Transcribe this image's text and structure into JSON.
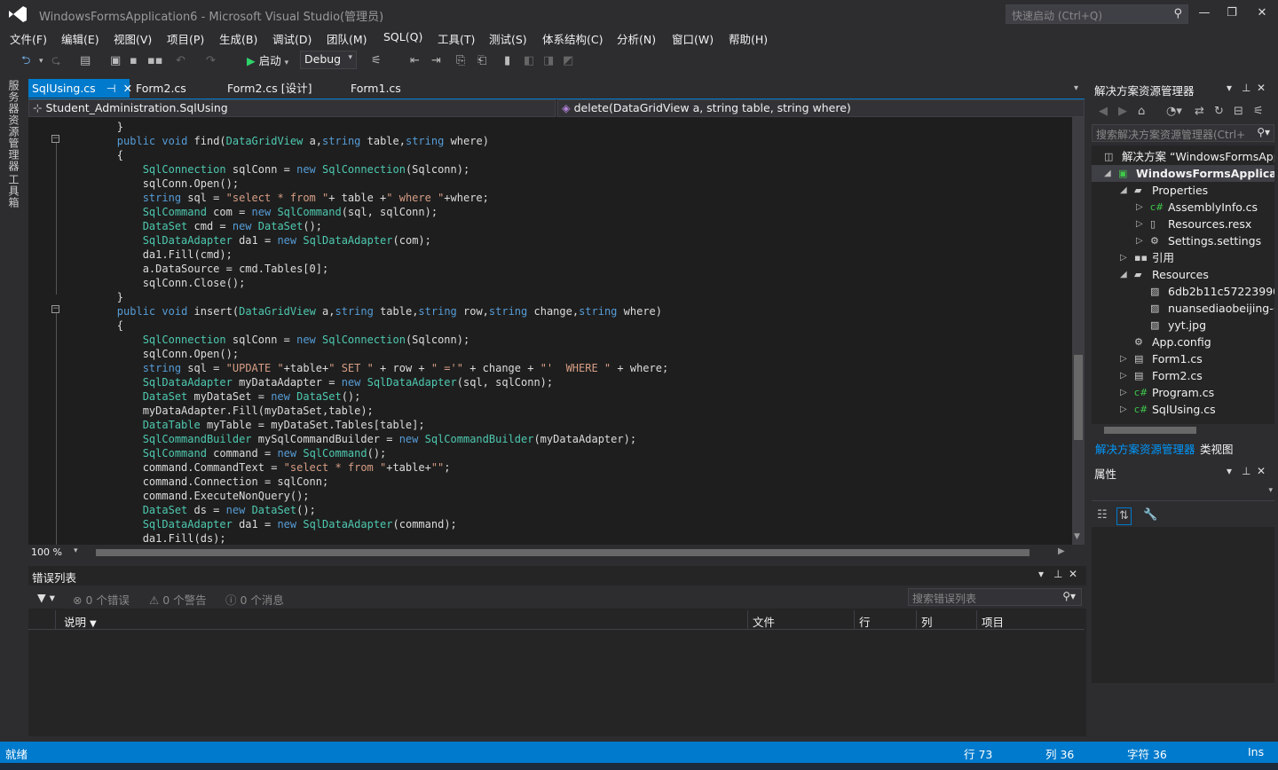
{
  "title": {
    "window_title": "WindowsFormsApplication6 - Microsoft Visual Studio(管理员)",
    "quick_launch": "快速启动 (Ctrl+Q)"
  },
  "menu": [
    "文件(F)",
    "编辑(E)",
    "视图(V)",
    "项目(P)",
    "生成(B)",
    "调试(D)",
    "团队(M)",
    "SQL(Q)",
    "工具(T)",
    "测试(S)",
    "体系结构(C)",
    "分析(N)",
    "窗口(W)",
    "帮助(H)"
  ],
  "toolbar": {
    "start_label": "启动",
    "config": "Debug"
  },
  "left_tabs": [
    "服务器资源管理器",
    "工具箱"
  ],
  "tabs": [
    "SqlUsing.cs",
    "Form2.cs",
    "Form2.cs [设计]",
    "Form1.cs"
  ],
  "nav": {
    "left": "Student_Administration.SqlUsing",
    "right": "delete(DataGridView a, string table, string where)"
  },
  "code_lines": [
    "        }",
    "        public void find(DataGridView a,string table,string where)",
    "        {",
    "            SqlConnection sqlConn = new SqlConnection(Sqlconn);",
    "            sqlConn.Open();",
    "            string sql = \"select * from \"+ table +\" where \"+where;",
    "            SqlCommand com = new SqlCommand(sql, sqlConn);",
    "            DataSet cmd = new DataSet();",
    "            SqlDataAdapter da1 = new SqlDataAdapter(com);",
    "            da1.Fill(cmd);",
    "            a.DataSource = cmd.Tables[0];",
    "            sqlConn.Close();",
    "        }",
    "        public void insert(DataGridView a,string table,string row,string change,string where)",
    "        {",
    "            SqlConnection sqlConn = new SqlConnection(Sqlconn);",
    "            sqlConn.Open();",
    "            string sql = \"UPDATE \"+table+\" SET \" + row + \" ='\" + change + \"'  WHERE \" + where;",
    "            SqlDataAdapter myDataAdapter = new SqlDataAdapter(sql, sqlConn);",
    "            DataSet myDataSet = new DataSet();",
    "            myDataAdapter.Fill(myDataSet,table);",
    "            DataTable myTable = myDataSet.Tables[table];",
    "            SqlCommandBuilder mySqlCommandBuilder = new SqlCommandBuilder(myDataAdapter);",
    "            SqlCommand command = new SqlCommand();",
    "            command.CommandText = \"select * from \"+table+\"\";",
    "            command.Connection = sqlConn;",
    "            command.ExecuteNonQuery();",
    "            DataSet ds = new DataSet();",
    "            SqlDataAdapter da1 = new SqlDataAdapter(command);",
    "            da1.Fill(ds);"
  ],
  "editor": {
    "zoom": "100 %"
  },
  "error_list": {
    "title": "错误列表",
    "errors": "0 个错误",
    "warnings": "0 个警告",
    "messages": "0 个消息",
    "search_placeholder": "搜索错误列表",
    "columns": [
      "说明",
      "文件",
      "行",
      "列",
      "项目"
    ]
  },
  "solution_explorer": {
    "title": "解决方案资源管理器",
    "search_placeholder": "搜索解决方案资源管理器(Ctrl+",
    "items": [
      {
        "label": "解决方案 “WindowsFormsApp",
        "icon": "solution-icon"
      },
      {
        "label": "WindowsFormsApplicatio",
        "icon": "csharp-project-icon"
      },
      {
        "label": "Properties",
        "icon": "properties-icon"
      },
      {
        "label": "AssemblyInfo.cs",
        "icon": "csharp-file-icon"
      },
      {
        "label": "Resources.resx",
        "icon": "resx-icon"
      },
      {
        "label": "Settings.settings",
        "icon": "settings-icon"
      },
      {
        "label": "引用",
        "icon": "references-icon"
      },
      {
        "label": "Resources",
        "icon": "folder-icon"
      },
      {
        "label": "6db2b11c57223990",
        "icon": "image-icon"
      },
      {
        "label": "nuansediaobeijing-(",
        "icon": "image-icon"
      },
      {
        "label": "yyt.jpg",
        "icon": "image-icon"
      },
      {
        "label": "App.config",
        "icon": "config-icon"
      },
      {
        "label": "Form1.cs",
        "icon": "form-icon"
      },
      {
        "label": "Form2.cs",
        "icon": "form-icon"
      },
      {
        "label": "Program.cs",
        "icon": "csharp-file-icon"
      },
      {
        "label": "SqlUsing.cs",
        "icon": "csharp-file-icon"
      }
    ],
    "bottom_tabs": [
      "解决方案资源管理器",
      "类视图"
    ]
  },
  "properties": {
    "title": "属性"
  },
  "status": {
    "ready": "就绪",
    "line": "行 73",
    "col": "列 36",
    "char": "字符 36",
    "mode": "Ins"
  },
  "colors": {
    "accent": "#007acc",
    "keyword": "#569cd6",
    "type": "#4ec9b0",
    "string": "#d69d85"
  }
}
